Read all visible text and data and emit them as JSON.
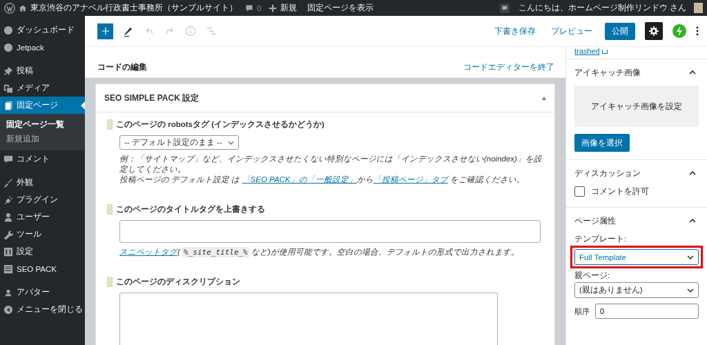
{
  "admin_bar": {
    "site_name": "東京渋谷のアナベル行政書士事務所（サンプルサイト）",
    "comments_count": "0",
    "new_label": "新規",
    "view_page": "固定ページを表示",
    "greeting": "こんにちは、ホームページ制作リンドウ さん"
  },
  "sidebar": {
    "items": [
      {
        "label": "ダッシュボード",
        "selected": false
      },
      {
        "label": "Jetpack",
        "selected": false
      },
      {
        "label": "投稿",
        "selected": false
      },
      {
        "label": "メディア",
        "selected": false
      },
      {
        "label": "固定ページ",
        "selected": true,
        "children": [
          {
            "label": "固定ページ一覧",
            "selected": true
          },
          {
            "label": "新規追加",
            "selected": false
          }
        ]
      },
      {
        "label": "コメント",
        "selected": false
      },
      {
        "label": "外観",
        "selected": false
      },
      {
        "label": "プラグイン",
        "selected": false
      },
      {
        "label": "ユーザー",
        "selected": false
      },
      {
        "label": "ツール",
        "selected": false
      },
      {
        "label": "設定",
        "selected": false
      },
      {
        "label": "SEO PACK",
        "selected": false
      },
      {
        "label": "アバター",
        "selected": false
      },
      {
        "label": "メニューを閉じる",
        "selected": false
      }
    ]
  },
  "toolbar": {
    "save_draft": "下書き保存",
    "preview": "プレビュー",
    "publish": "公開"
  },
  "code_editor": {
    "title": "コードの編集",
    "exit": "コードエディターを終了"
  },
  "seo_panel": {
    "title": "SEO SIMPLE PACK 設定",
    "fields": [
      {
        "kind": "select",
        "label": "このページの robotsタグ (インデックスさせるかどうか)",
        "value": "-- デフォルト設定のまま --",
        "help": [
          [
            {
              "kind": "text",
              "text": "例：「サイトマップ」など、インデックスさせたくない特別なページには「インデックスさせない(noindex)」を設定してください。"
            }
          ],
          [
            {
              "kind": "text",
              "text": "投稿ページの デフォルト設定 は "
            },
            {
              "kind": "link",
              "text": "「SEO PACK」の「一般設定」"
            },
            {
              "kind": "text",
              "text": "から"
            },
            {
              "kind": "link",
              "text": "「投稿ページ」タブ"
            },
            {
              "kind": "text",
              "text": " をご確認ください。"
            }
          ]
        ]
      },
      {
        "kind": "input",
        "label": "このページのタイトルタグを上書きする",
        "help": [
          [
            {
              "kind": "link",
              "text": "スニペットタグ"
            },
            {
              "kind": "text",
              "text": "( "
            },
            {
              "kind": "code",
              "text": "%_site_title_%"
            },
            {
              "kind": "text",
              "text": " など)が使用可能です。空白の場合、デフォルトの形式で出力されます。"
            }
          ]
        ]
      },
      {
        "kind": "textarea",
        "label": "このページのディスクリプション"
      }
    ]
  },
  "settings_sidebar": {
    "trashed_link": "trashed",
    "featured_image": {
      "title": "アイキャッチ画像",
      "set_label": "アイキャッチ画像を設定",
      "button": "画像を選択",
      "expanded": true
    },
    "discussion": {
      "title": "ディスカッション",
      "expanded": true,
      "allow_comments": {
        "label": "コメントを許可",
        "checked": false
      }
    },
    "page_attributes": {
      "title": "ページ属性",
      "expanded": true,
      "template_label": "テンプレート:",
      "template_value": "Full Template",
      "template_highlighted": true,
      "parent_label": "親ページ:",
      "parent_value": "(親はありません)",
      "order_label": "順序",
      "order_value": "0"
    }
  }
}
